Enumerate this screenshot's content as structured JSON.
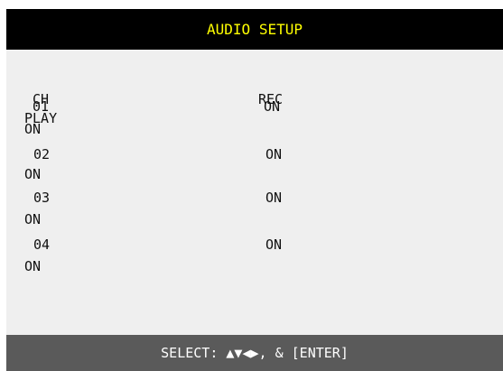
{
  "header": {
    "title": "AUDIO SETUP"
  },
  "columns": {
    "ch": "CH",
    "play": "PLAY",
    "rec": "REC"
  },
  "rows": [
    {
      "ch": "01",
      "play": "ON",
      "rec": "ON"
    },
    {
      "ch": "02",
      "play": "ON",
      "rec": "ON"
    },
    {
      "ch": "03",
      "play": "ON",
      "rec": "ON"
    },
    {
      "ch": "04",
      "play": "ON",
      "rec": "ON"
    }
  ],
  "footer": {
    "hint": "SELECT: ▲▼◀▶, & [ENTER]"
  },
  "colors": {
    "header_bg": "#000000",
    "header_text": "#ffff00",
    "panel_bg": "#efefef",
    "footer_bg": "#5a5a5a",
    "footer_text": "#ffffff"
  }
}
